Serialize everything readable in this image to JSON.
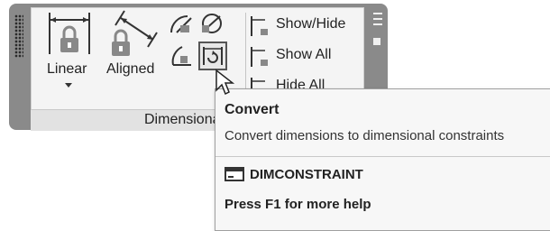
{
  "panel": {
    "title": "Dimensional",
    "buttons": {
      "linear": "Linear",
      "aligned": "Aligned"
    },
    "list": {
      "show_hide": "Show/Hide",
      "show_all": "Show All",
      "hide_all": "Hide All"
    }
  },
  "tooltip": {
    "title": "Convert",
    "description": "Convert dimensions to dimensional constraints",
    "command": "DIMCONSTRAINT",
    "help": "Press F1 for more help"
  },
  "icons": [
    "linear-dimension-icon",
    "aligned-dimension-icon",
    "angular-icon",
    "diameter-icon",
    "radial-icon",
    "convert-icon",
    "show-hide-icon",
    "show-all-icon",
    "hide-all-icon",
    "command-icon",
    "mouse-cursor-icon"
  ],
  "colors": {
    "panel_frame": "#8a8a8a",
    "panel_body": "#f4f4f4",
    "tooltip_bg": "#f7f7f7"
  }
}
